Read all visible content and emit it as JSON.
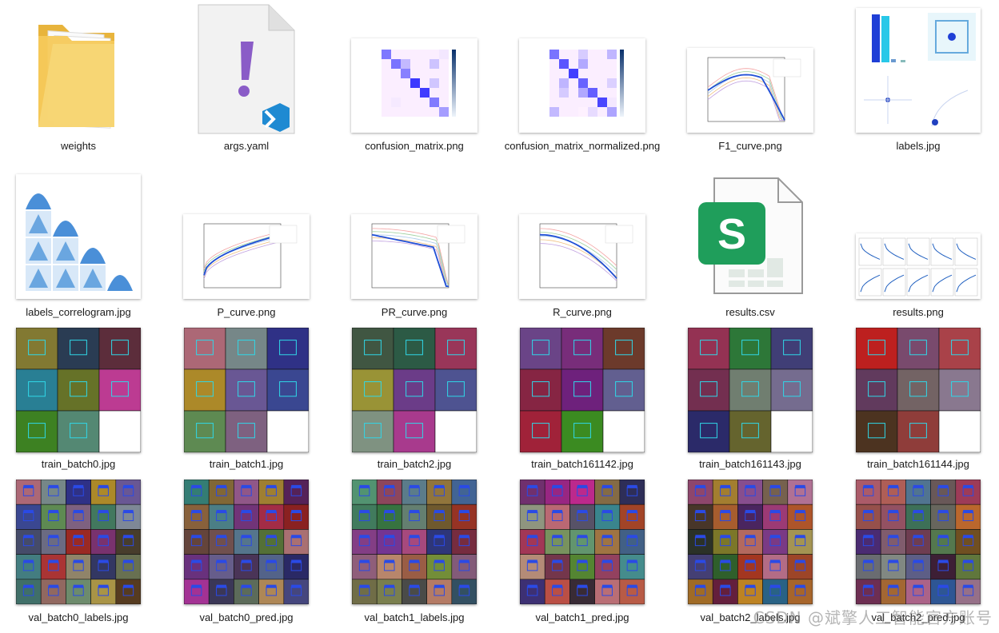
{
  "files": [
    {
      "name": "weights",
      "kind": "folder"
    },
    {
      "name": "args.yaml",
      "kind": "yaml"
    },
    {
      "name": "confusion_matrix.png",
      "kind": "matrix"
    },
    {
      "name": "confusion_matrix_normalized.png",
      "kind": "matrix"
    },
    {
      "name": "F1_curve.png",
      "kind": "curve-f1"
    },
    {
      "name": "labels.jpg",
      "kind": "labels"
    },
    {
      "name": "labels_correlogram.jpg",
      "kind": "correlogram"
    },
    {
      "name": "P_curve.png",
      "kind": "curve-p"
    },
    {
      "name": "PR_curve.png",
      "kind": "curve-pr"
    },
    {
      "name": "R_curve.png",
      "kind": "curve-r"
    },
    {
      "name": "results.csv",
      "kind": "csv"
    },
    {
      "name": "results.png",
      "kind": "results"
    },
    {
      "name": "train_batch0.jpg",
      "kind": "mosaic-train"
    },
    {
      "name": "train_batch1.jpg",
      "kind": "mosaic-train"
    },
    {
      "name": "train_batch2.jpg",
      "kind": "mosaic-train"
    },
    {
      "name": "train_batch161142.jpg",
      "kind": "mosaic-train"
    },
    {
      "name": "train_batch161143.jpg",
      "kind": "mosaic-train"
    },
    {
      "name": "train_batch161144.jpg",
      "kind": "mosaic-train"
    },
    {
      "name": "val_batch0_labels.jpg",
      "kind": "mosaic-val"
    },
    {
      "name": "val_batch0_pred.jpg",
      "kind": "mosaic-val"
    },
    {
      "name": "val_batch1_labels.jpg",
      "kind": "mosaic-val"
    },
    {
      "name": "val_batch1_pred.jpg",
      "kind": "mosaic-val"
    },
    {
      "name": "val_batch2_labels.jpg",
      "kind": "mosaic-val"
    },
    {
      "name": "val_batch2_pred.jpg",
      "kind": "mosaic-val"
    }
  ],
  "csv_letter": "S",
  "watermark": "CSDN @斌擎人工智能官方账号",
  "colors": {
    "folder": "#f5c95a",
    "vscode": "#1f8ad2",
    "yaml_mark": "#8a5cc7",
    "csv": "#1f9e5b",
    "accent_blue": "#1f4fd6"
  }
}
